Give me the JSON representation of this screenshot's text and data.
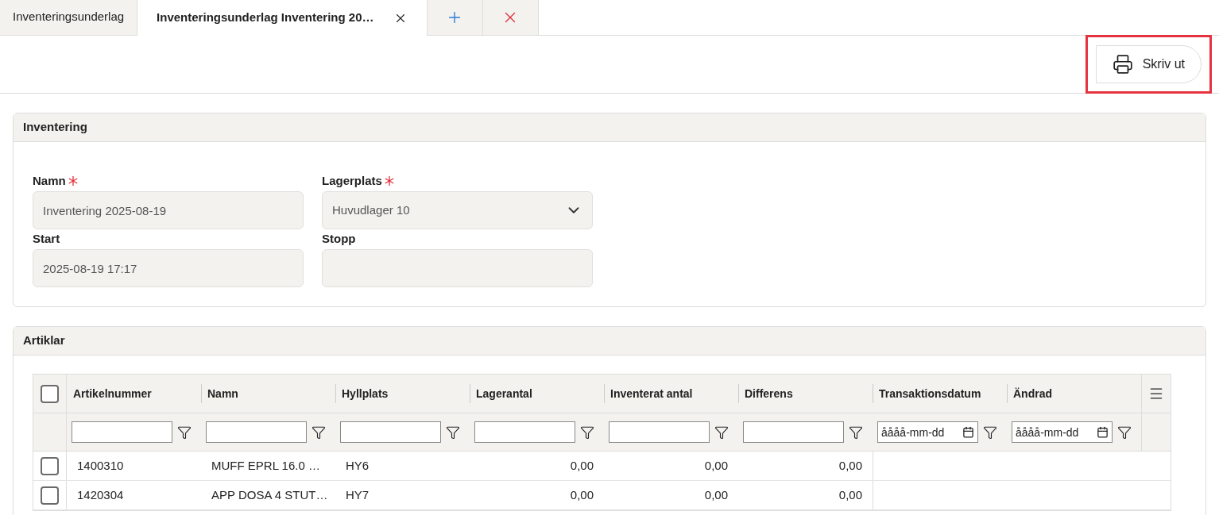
{
  "tabs": [
    {
      "label": "Inventeringsunderlag",
      "selected": false
    },
    {
      "label": "Inventeringsunderlag Inventering 20…",
      "selected": true
    }
  ],
  "toolbar": {
    "print_button": "Skriv ut",
    "highlighted": true
  },
  "inventory_panel": {
    "title": "Inventering",
    "fields": [
      {
        "label": "Namn",
        "required": true,
        "kind": "text",
        "value": "Inventering 2025-08-19"
      },
      {
        "label": "Lagerplats",
        "required": true,
        "kind": "select",
        "value": "Huvudlager 10"
      },
      {
        "label": "Start",
        "kind": "text",
        "value": "2025-08-19 17:17"
      },
      {
        "label": "Stopp",
        "kind": "text"
      }
    ]
  },
  "articles_panel": {
    "title": "Artiklar",
    "all_checked": false,
    "columns": [
      {
        "label": "Artikelnummer",
        "kind": "text"
      },
      {
        "label": "Namn",
        "kind": "text"
      },
      {
        "label": "Hyllplats",
        "kind": "text"
      },
      {
        "label": "Lagerantal",
        "kind": "number"
      },
      {
        "label": "Inventerat antal",
        "kind": "number"
      },
      {
        "label": "Differens",
        "kind": "number"
      },
      {
        "label": "Transaktionsdatum",
        "kind": "date",
        "placeholder": "åååå-mm-dd"
      },
      {
        "label": "Ändrad",
        "kind": "date",
        "placeholder": "åååå-mm-dd"
      }
    ],
    "rows": [
      {
        "checked": false,
        "cells": [
          "1400310",
          "MUFF EPRL 16.0 …",
          "HY6",
          "0,00",
          "0,00",
          "0,00"
        ]
      },
      {
        "checked": false,
        "cells": [
          "1420304",
          "APP DOSA 4 STUT…",
          "HY7",
          "0,00",
          "0,00",
          "0,00"
        ]
      }
    ]
  }
}
